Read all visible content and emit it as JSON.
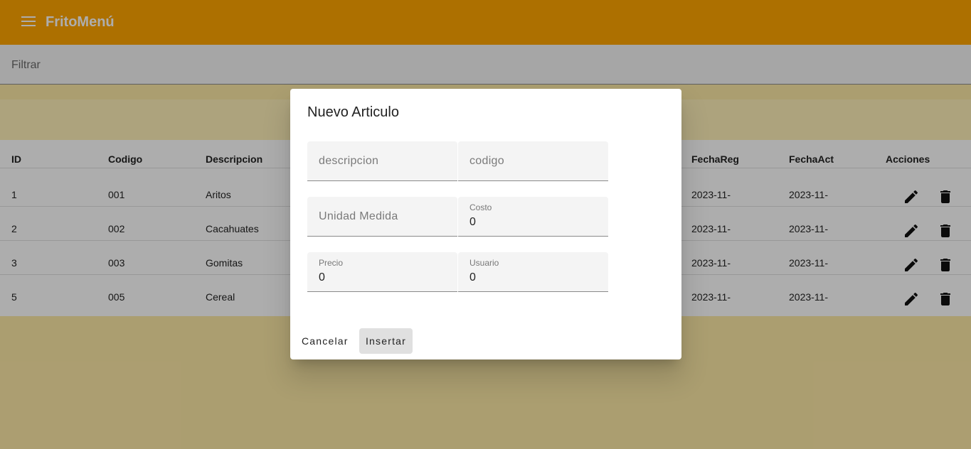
{
  "app": {
    "title": "FritoMenú"
  },
  "filter": {
    "placeholder": "Filtrar"
  },
  "table": {
    "headers": {
      "id": "ID",
      "codigo": "Codigo",
      "descripcion": "Descripcion",
      "fechareg": "FechaReg",
      "fechaact": "FechaAct",
      "acciones": "Acciones"
    },
    "rows": [
      {
        "id": "1",
        "codigo": "001",
        "descripcion": "Aritos",
        "fechareg": "2023-11-",
        "fechaact": "2023-11-"
      },
      {
        "id": "2",
        "codigo": "002",
        "descripcion": "Cacahuates",
        "fechareg": "2023-11-",
        "fechaact": "2023-11-"
      },
      {
        "id": "3",
        "codigo": "003",
        "descripcion": "Gomitas",
        "fechareg": "2023-11-",
        "fechaact": "2023-11-"
      },
      {
        "id": "5",
        "codigo": "005",
        "descripcion": "Cereal",
        "fechareg": "2023-11-",
        "fechaact": "2023-11-"
      }
    ]
  },
  "dialog": {
    "title": "Nuevo Articulo",
    "fields": {
      "descripcion": {
        "placeholder": "descripcion"
      },
      "codigo": {
        "placeholder": "codigo"
      },
      "unidad": {
        "placeholder": "Unidad Medida"
      },
      "costo": {
        "label": "Costo",
        "value": "0"
      },
      "precio": {
        "label": "Precio",
        "value": "0"
      },
      "usuario": {
        "label": "Usuario",
        "value": "0"
      }
    },
    "buttons": {
      "cancel": "Cancelar",
      "insert": "Insertar"
    }
  },
  "colors": {
    "toolbar": "#ffa500",
    "band": "#fff1b8",
    "background": "#fde9a6"
  },
  "icons": {
    "menu": "menu-icon",
    "edit": "edit-icon",
    "delete": "delete-icon"
  }
}
